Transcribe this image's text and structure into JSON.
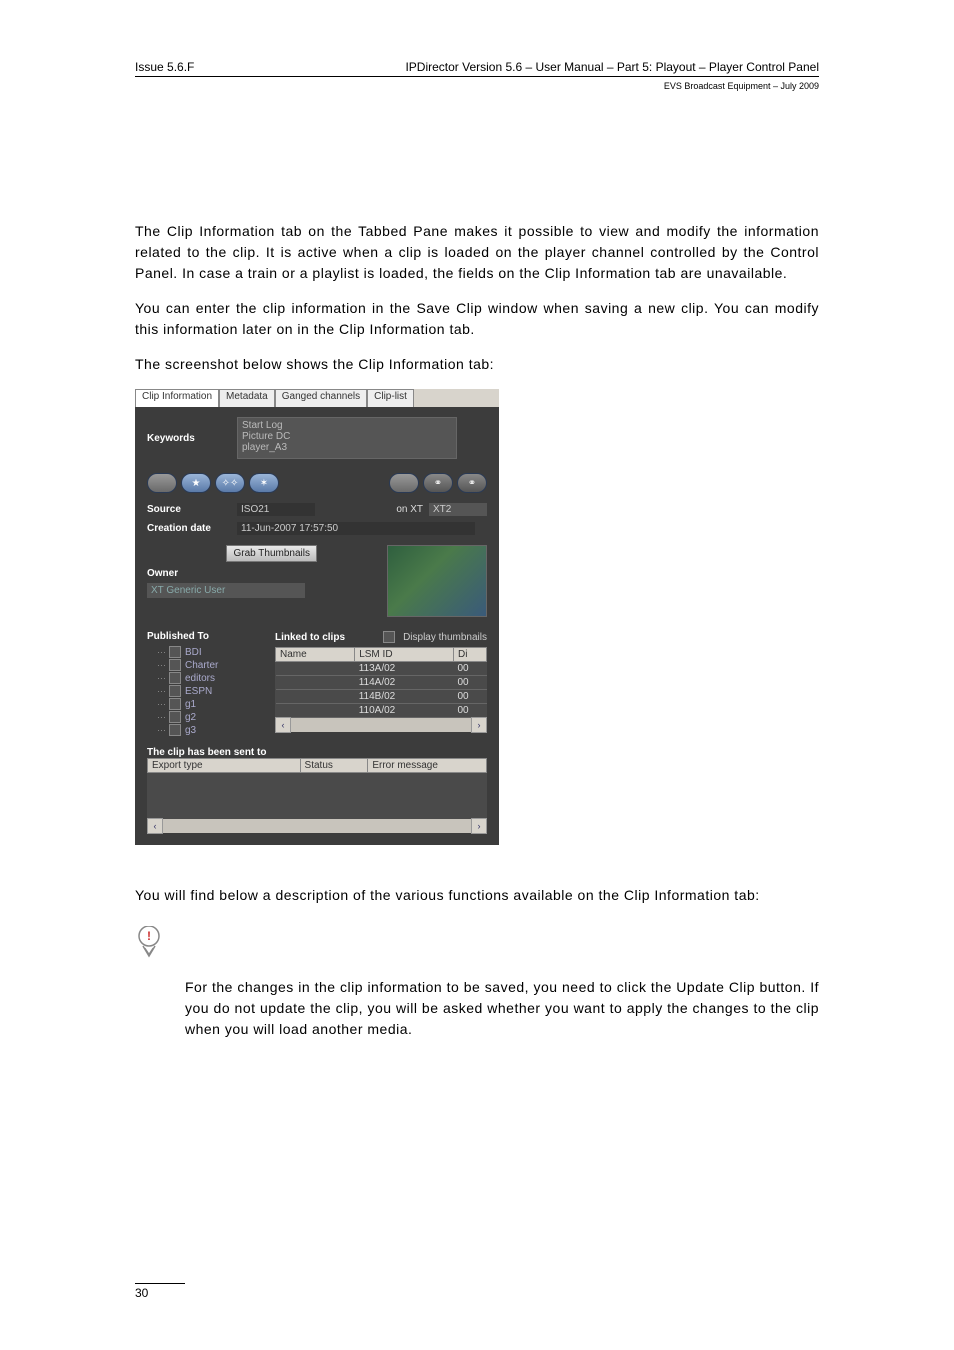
{
  "header": {
    "issue": "Issue 5.6.F",
    "title": "IPDirector Version 5.6 – User Manual – Part 5: Playout – Player Control Panel",
    "sub": "EVS Broadcast Equipment – July 2009"
  },
  "paragraphs": {
    "p1": "The Clip Information tab on the Tabbed Pane makes it possible to view and modify the information related to the clip. It is active when a clip is loaded on the player channel controlled by the Control Panel. In case a train or a playlist is loaded, the fields on the Clip Information tab are unavailable.",
    "p2": "You can enter the clip information in the Save Clip window when saving a new clip. You can modify this information later on in the Clip Information tab.",
    "p3": "The screenshot below shows the Clip Information tab:",
    "p4": "You will find below a description of the various functions available on the Clip Information tab:",
    "note": "For the changes in the clip information to be saved, you need to click the Update Clip button. If you do not update the clip, you will be asked whether you want to apply the changes to the clip when you will load another media."
  },
  "shot": {
    "tabs": [
      "Clip Information",
      "Metadata",
      "Ganged channels",
      "Clip-list"
    ],
    "keywords_label": "Keywords",
    "keywords_value": "Start Log\nPicture DC\nplayer_A3",
    "source_label": "Source",
    "source_value": "ISO21",
    "onxt": "on XT",
    "xt2": "XT2",
    "creation_label": "Creation date",
    "creation_value": "11-Jun-2007 17:57:50",
    "grab_label": "Grab Thumbnails",
    "owner_label": "Owner",
    "owner_value": "XT Generic User",
    "published_label": "Published To",
    "tree_items": [
      "BDI",
      "Charter",
      "editors",
      "ESPN",
      "g1",
      "g2",
      "g3"
    ],
    "linked_label": "Linked to clips",
    "display_thumbs_label": "Display thumbnails",
    "linked_headers": [
      "Name",
      "LSM ID",
      "Di"
    ],
    "linked_rows": [
      {
        "name": "",
        "lsm": "113A/02",
        "d": "00"
      },
      {
        "name": "",
        "lsm": "114A/02",
        "d": "00"
      },
      {
        "name": "",
        "lsm": "114B/02",
        "d": "00"
      },
      {
        "name": "",
        "lsm": "110A/02",
        "d": "00"
      }
    ],
    "sent_label": "The clip has been sent to",
    "sent_headers": [
      "Export type",
      "Status",
      "Error message"
    ]
  },
  "footer": {
    "page": "30"
  }
}
